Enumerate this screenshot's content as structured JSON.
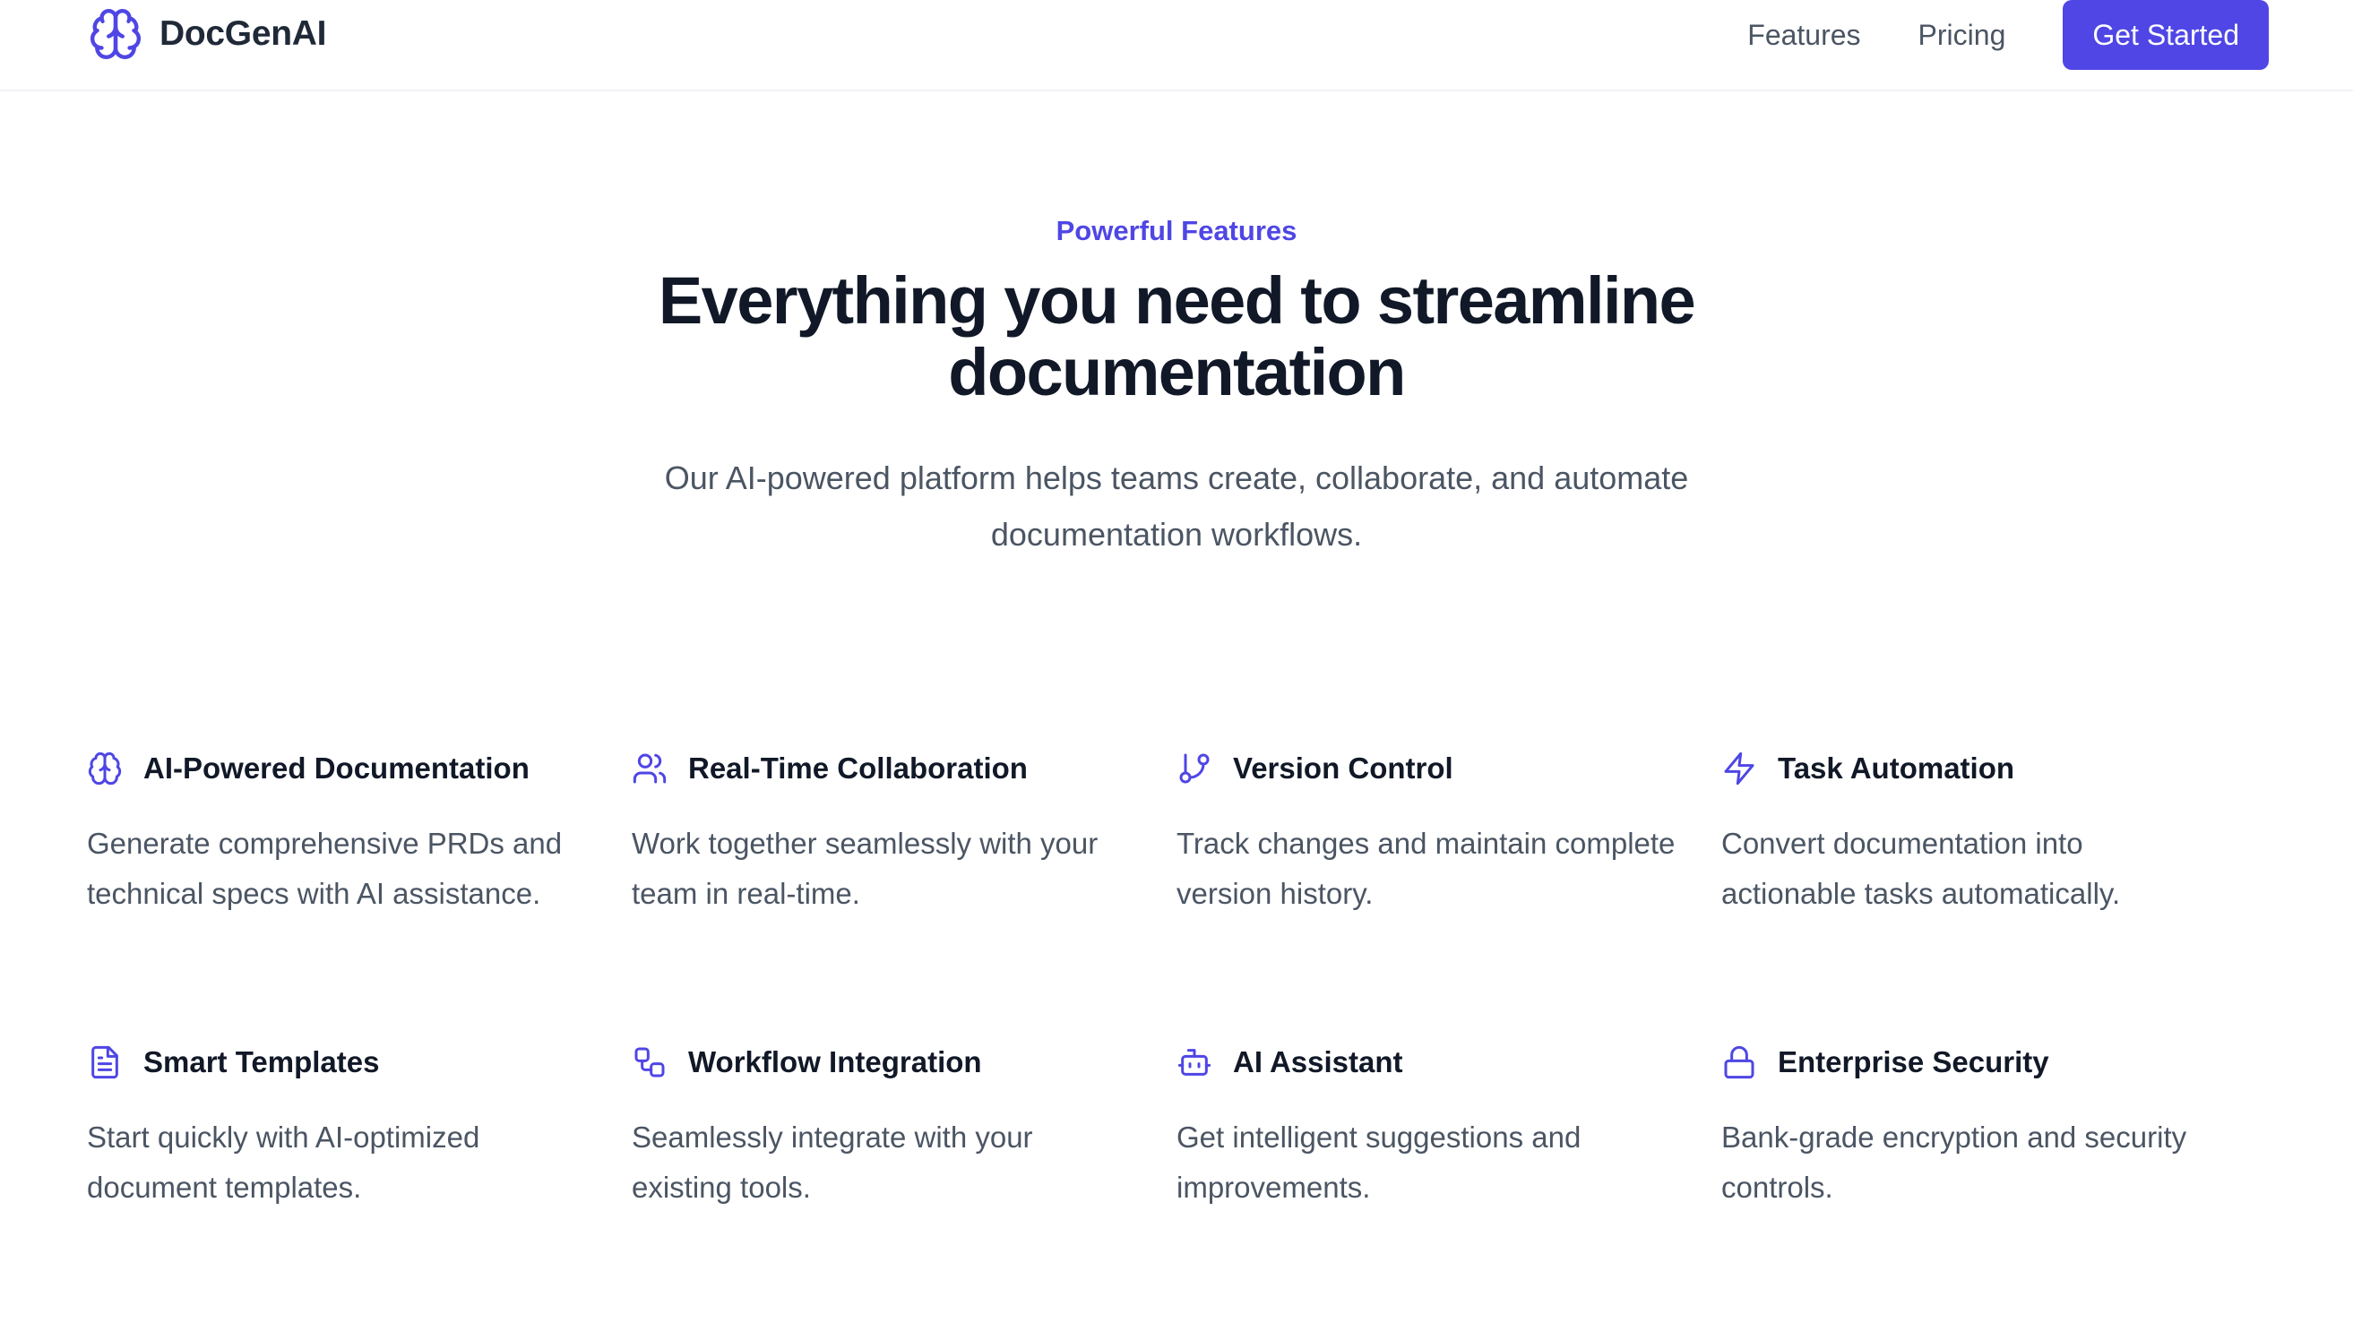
{
  "brand": {
    "name": "DocGenAI",
    "icon": "brain-icon"
  },
  "nav": {
    "links": [
      "Features",
      "Pricing"
    ],
    "cta": "Get Started"
  },
  "hero": {
    "eyebrow": "Powerful Features",
    "title": "Everything you need to streamline documentation",
    "subtitle": "Our AI-powered platform helps teams create, collaborate, and automate documentation workflows."
  },
  "features": [
    {
      "icon": "brain-icon",
      "title": "AI-Powered Documentation",
      "description": "Generate comprehensive PRDs and technical specs with AI assistance."
    },
    {
      "icon": "users-icon",
      "title": "Real-Time Collaboration",
      "description": "Work together seamlessly with your team in real-time."
    },
    {
      "icon": "git-branch-icon",
      "title": "Version Control",
      "description": "Track changes and maintain complete version history."
    },
    {
      "icon": "lightning-icon",
      "title": "Task Automation",
      "description": "Convert documentation into actionable tasks automatically."
    },
    {
      "icon": "document-icon",
      "title": "Smart Templates",
      "description": "Start quickly with AI-optimized document templates."
    },
    {
      "icon": "workflow-icon",
      "title": "Workflow Integration",
      "description": "Seamlessly integrate with your existing tools."
    },
    {
      "icon": "bot-icon",
      "title": "AI Assistant",
      "description": "Get intelligent suggestions and improvements."
    },
    {
      "icon": "lock-icon",
      "title": "Enterprise Security",
      "description": "Bank-grade encryption and security controls."
    }
  ],
  "colors": {
    "accent": "#4f46e5",
    "heading": "#111827",
    "body": "#4b5563"
  }
}
